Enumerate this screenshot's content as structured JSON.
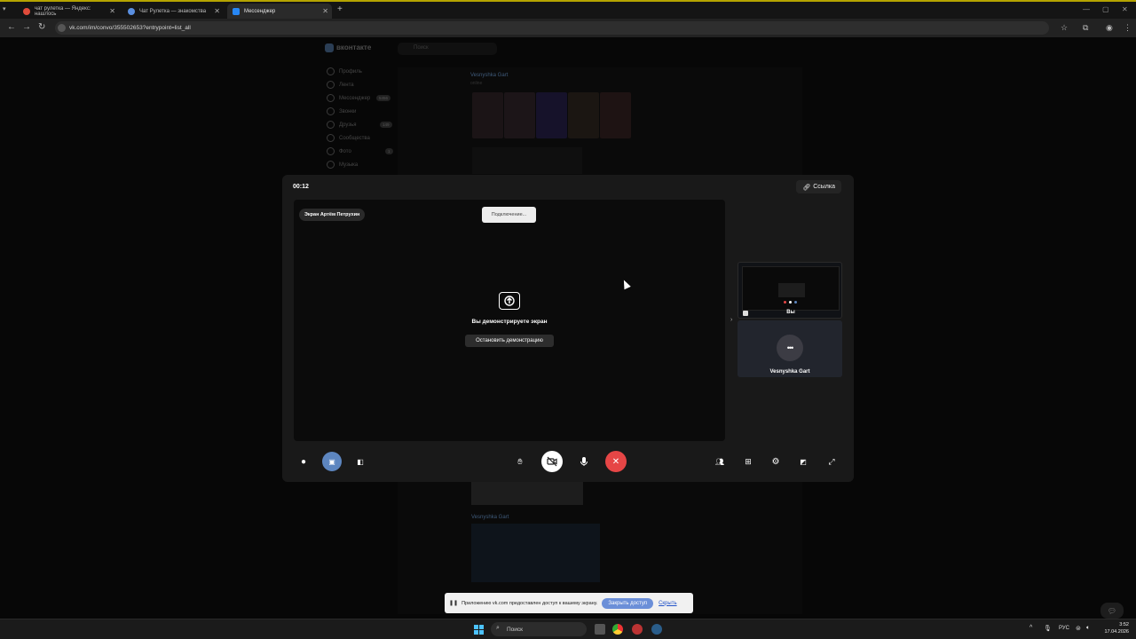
{
  "browser": {
    "tabs": [
      {
        "label": "чат рулетка — Яндекс: нашлось",
        "favicon_color": "#e04b3a"
      },
      {
        "label": "Чат Рулетка — знакомства",
        "favicon_color": "#5a8fe0"
      },
      {
        "label": "Мессенджер",
        "favicon_color": "#2787f5"
      }
    ],
    "url": "vk.com/im/convo/355502653?entrypoint=list_all"
  },
  "vk_background": {
    "logo": "вконтакте",
    "search_placeholder": "Поиск",
    "sidebar": [
      {
        "label": "Профиль"
      },
      {
        "label": "Лента"
      },
      {
        "label": "Мессенджер",
        "badge": "5456"
      },
      {
        "label": "Звонки"
      },
      {
        "label": "Друзья",
        "badge": "149"
      },
      {
        "label": "Сообщества"
      },
      {
        "label": "Фото",
        "badge": "1"
      },
      {
        "label": "Музыка"
      }
    ],
    "chat_name": "Vesnyshka Gart",
    "chat_status": "online",
    "chat_name_2": "Vesnyshka Gart"
  },
  "call": {
    "timer": "00:12",
    "link_label": "Ссылка",
    "screen_label": "Экран Артём Петрухин",
    "connecting_label": "Подключение...",
    "sharing_text": "Вы демонстрируете экран",
    "stop_button": "Остановить демонстрацию",
    "tile_you": "Вы",
    "tile_other": "Vesnyshka Gart",
    "tile_other_avatar": "•••"
  },
  "share_notice": {
    "text": "Приложению vk.com предоставлен доступ к вашему экрану.",
    "stop_label": "Закрыть доступ",
    "hide_label": "Скрыть"
  },
  "taskbar": {
    "search_label": "Поиск",
    "lang": "РУС",
    "time": "3:52",
    "date": "17.04.2026"
  },
  "colors": {
    "accent_blue": "#5d86c0",
    "end_call_red": "#e64646",
    "windows_blue": "#4cc2ff"
  }
}
